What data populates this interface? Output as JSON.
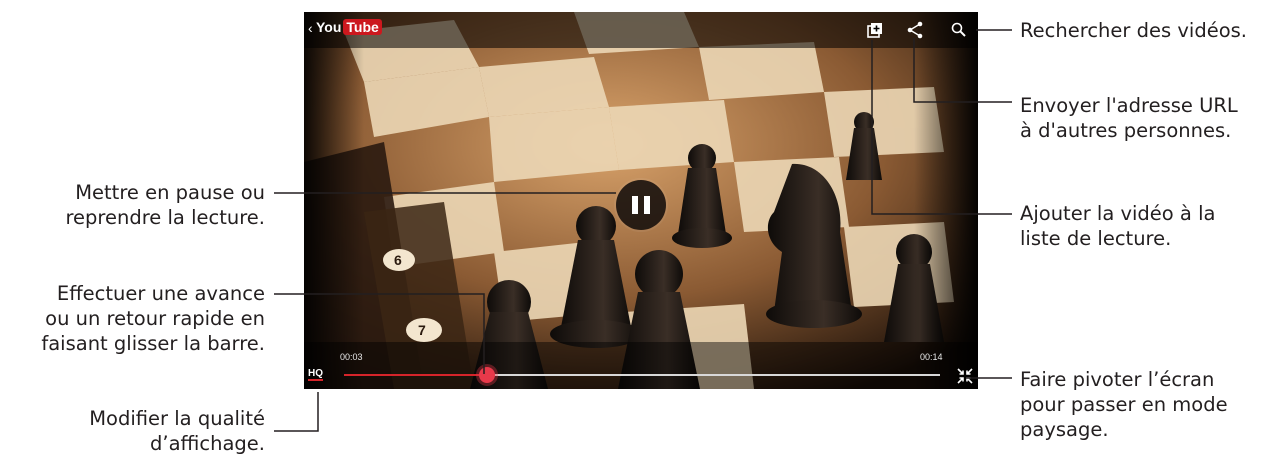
{
  "player": {
    "back_glyph": "‹",
    "logo_you": "You",
    "logo_tube": "Tube",
    "time_current": "00:03",
    "time_total": "00:14",
    "progress": 0.24,
    "hq_label": "HQ",
    "accent_color": "#d6242a",
    "icons": {
      "back": "chevron-left-icon",
      "playlist": "add-to-playlist-icon",
      "share": "share-icon",
      "search": "search-icon",
      "pause": "pause-icon",
      "rotate": "rotate-screen-icon"
    }
  },
  "callouts": {
    "search": [
      "Rechercher des vidéos."
    ],
    "share": [
      "Envoyer l'adresse URL",
      "à d'autres personnes."
    ],
    "playlist": [
      "Ajouter la vidéo à la",
      "liste de lecture."
    ],
    "rotate": [
      "Faire pivoter l’écran",
      "pour passer en mode",
      "paysage."
    ],
    "pause": [
      "Mettre en pause ou",
      "reprendre la lecture."
    ],
    "seek": [
      "Effectuer une avance",
      "ou un retour rapide en",
      "faisant glisser la barre."
    ],
    "quality": [
      "Modifier la qualité",
      "d’affichage."
    ]
  }
}
